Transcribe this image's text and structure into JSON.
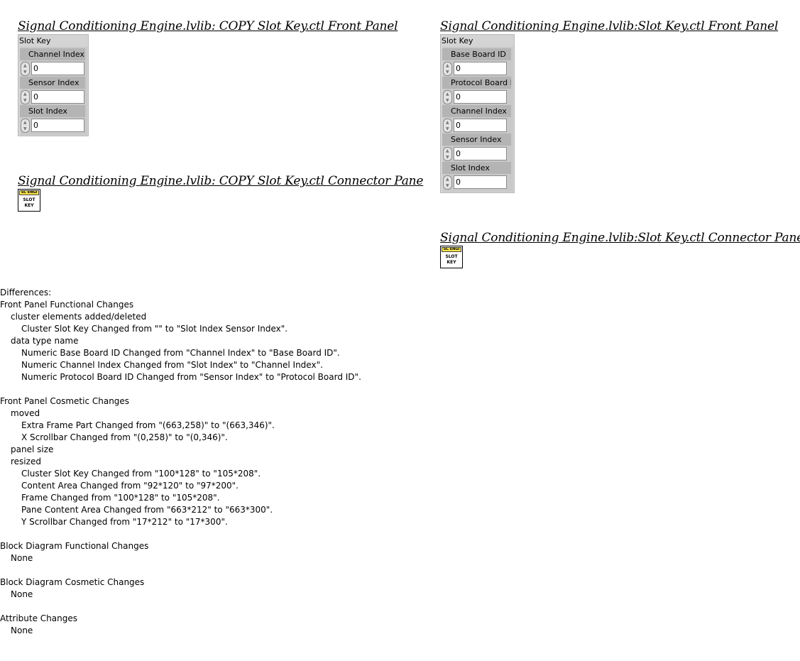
{
  "left": {
    "front_panel_title": "Signal Conditioning Engine.lvlib:  COPY  Slot Key.ctl Front Panel",
    "cluster_label": "Slot Key",
    "controls": [
      {
        "label": "Channel Index",
        "value": "0"
      },
      {
        "label": "Sensor Index",
        "value": "0"
      },
      {
        "label": "Slot Index",
        "value": "0"
      }
    ],
    "connector_title": "Signal Conditioning Engine.lvlib:  COPY  Slot Key.ctl Connector Pane",
    "icon_top": "SC ENGI",
    "icon_line1": "SLOT",
    "icon_line2": "KEY"
  },
  "right": {
    "front_panel_title": "Signal Conditioning Engine.lvlib:Slot Key.ctl Front Panel",
    "cluster_label": "Slot Key",
    "controls": [
      {
        "label": "Base Board ID",
        "value": "0"
      },
      {
        "label": "Protocol Board ID",
        "value": "0"
      },
      {
        "label": "Channel Index",
        "value": "0"
      },
      {
        "label": "Sensor Index",
        "value": "0"
      },
      {
        "label": "Slot Index",
        "value": "0"
      }
    ],
    "connector_title": "Signal Conditioning Engine.lvlib:Slot Key.ctl Connector Pane",
    "icon_top": "SC ENGI",
    "icon_line1": "SLOT",
    "icon_line2": "KEY"
  },
  "differences": [
    {
      "level": 0,
      "text": "Differences:"
    },
    {
      "level": 0,
      "text": "Front Panel Functional Changes"
    },
    {
      "level": 1,
      "text": "cluster elements added/deleted"
    },
    {
      "level": 2,
      "text": "Cluster Slot Key Changed from \"\" to \"Slot Index Sensor Index\"."
    },
    {
      "level": 1,
      "text": "data type name"
    },
    {
      "level": 2,
      "text": "Numeric Base Board ID Changed from \"Channel Index\" to \"Base Board ID\"."
    },
    {
      "level": 2,
      "text": "Numeric Channel Index Changed from \"Slot Index\" to \"Channel Index\"."
    },
    {
      "level": 2,
      "text": "Numeric Protocol Board ID Changed from \"Sensor Index\" to \"Protocol Board ID\"."
    },
    {
      "level": 0,
      "text": ""
    },
    {
      "level": 0,
      "text": "Front Panel Cosmetic Changes"
    },
    {
      "level": 1,
      "text": "moved"
    },
    {
      "level": 2,
      "text": "Extra Frame Part  Changed from \"(663,258)\" to \"(663,346)\"."
    },
    {
      "level": 2,
      "text": "X Scrollbar  Changed from \"(0,258)\" to \"(0,346)\"."
    },
    {
      "level": 1,
      "text": "panel size"
    },
    {
      "level": 1,
      "text": "resized"
    },
    {
      "level": 2,
      "text": "Cluster Slot Key Changed from \"100*128\" to \"105*208\"."
    },
    {
      "level": 2,
      "text": "Content Area  Changed from \"92*120\" to \"97*200\"."
    },
    {
      "level": 2,
      "text": "Frame  Changed from \"100*128\" to \"105*208\"."
    },
    {
      "level": 2,
      "text": "Pane Content Area  Changed from \"663*212\" to \"663*300\"."
    },
    {
      "level": 2,
      "text": "Y Scrollbar  Changed from \"17*212\" to \"17*300\"."
    },
    {
      "level": 0,
      "text": ""
    },
    {
      "level": 0,
      "text": "Block Diagram Functional Changes"
    },
    {
      "level": 1,
      "text": "None"
    },
    {
      "level": 0,
      "text": ""
    },
    {
      "level": 0,
      "text": "Block Diagram Cosmetic Changes"
    },
    {
      "level": 1,
      "text": "None"
    },
    {
      "level": 0,
      "text": ""
    },
    {
      "level": 0,
      "text": "Attribute Changes"
    },
    {
      "level": 1,
      "text": "None"
    }
  ]
}
